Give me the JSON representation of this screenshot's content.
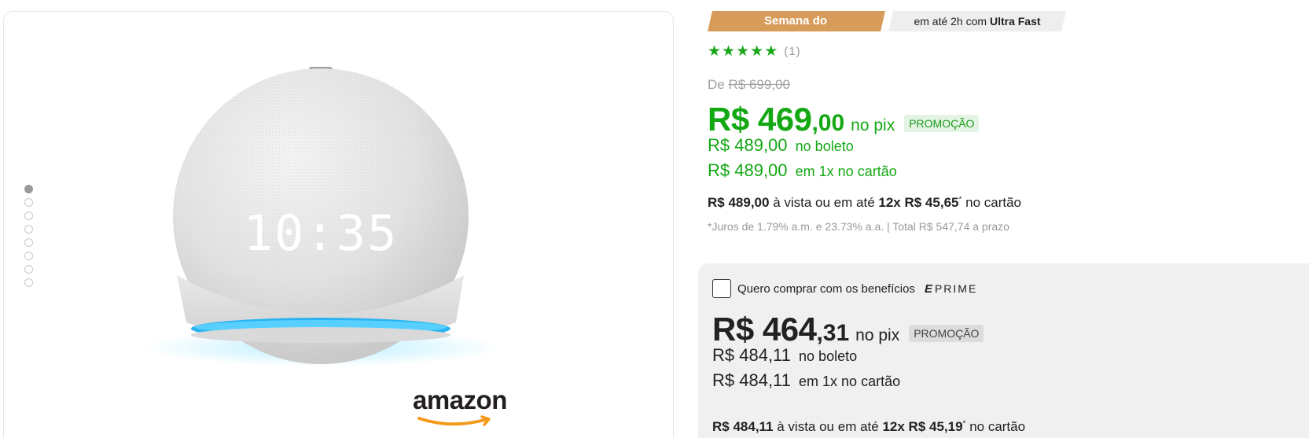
{
  "gallery": {
    "dots_count": 8,
    "active_dot": 0,
    "clock_text": "10:35",
    "brand_logo_text": "amazon"
  },
  "badges": {
    "promo": "Semana do Consumidor",
    "delivery_prefix": "em até 2h com",
    "delivery_bold": "Ultra Fast"
  },
  "rating": {
    "stars": 5,
    "count": "(1)"
  },
  "pricing": {
    "old_prefix": "De",
    "old_price": "R$ 699,00",
    "pix_main": "R$ 469",
    "pix_cents": ",00",
    "pix_suffix": "no pix",
    "pix_tag": "PROMOÇÃO",
    "boleto_price": "R$ 489,00",
    "boleto_suffix": "no boleto",
    "card_price": "R$ 489,00",
    "card_suffix": "em 1x no cartão",
    "installment_total": "R$ 489,00",
    "installment_mid": "à vista ou em até",
    "installment_parcel": "12x R$ 45,65",
    "installment_mark": "*",
    "installment_end": "no cartão",
    "interest_note": "*Juros de 1.79% a.m. e 23.73% a.a. | Total R$ 547,74 a prazo"
  },
  "prime": {
    "checkbox_label": "Quero comprar com os benefícios",
    "logo_mark": "E",
    "logo_text": "PRIME",
    "pix_main": "R$ 464",
    "pix_cents": ",31",
    "pix_suffix": "no pix",
    "pix_tag": "PROMOÇÃO",
    "boleto_price": "R$ 484,11",
    "boleto_suffix": "no boleto",
    "card_price": "R$ 484,11",
    "card_suffix": "em 1x no cartão",
    "installment_total": "R$ 484,11",
    "installment_mid": "à vista ou em até",
    "installment_parcel": "12x R$ 45,19",
    "installment_mark": "*",
    "installment_end": "no cartão"
  },
  "colors": {
    "promo_badge": "#d89c5a",
    "price_green": "#14a814",
    "prime_panel_bg": "#f0f0f0",
    "speaker_ring": "#2ab3f0"
  }
}
